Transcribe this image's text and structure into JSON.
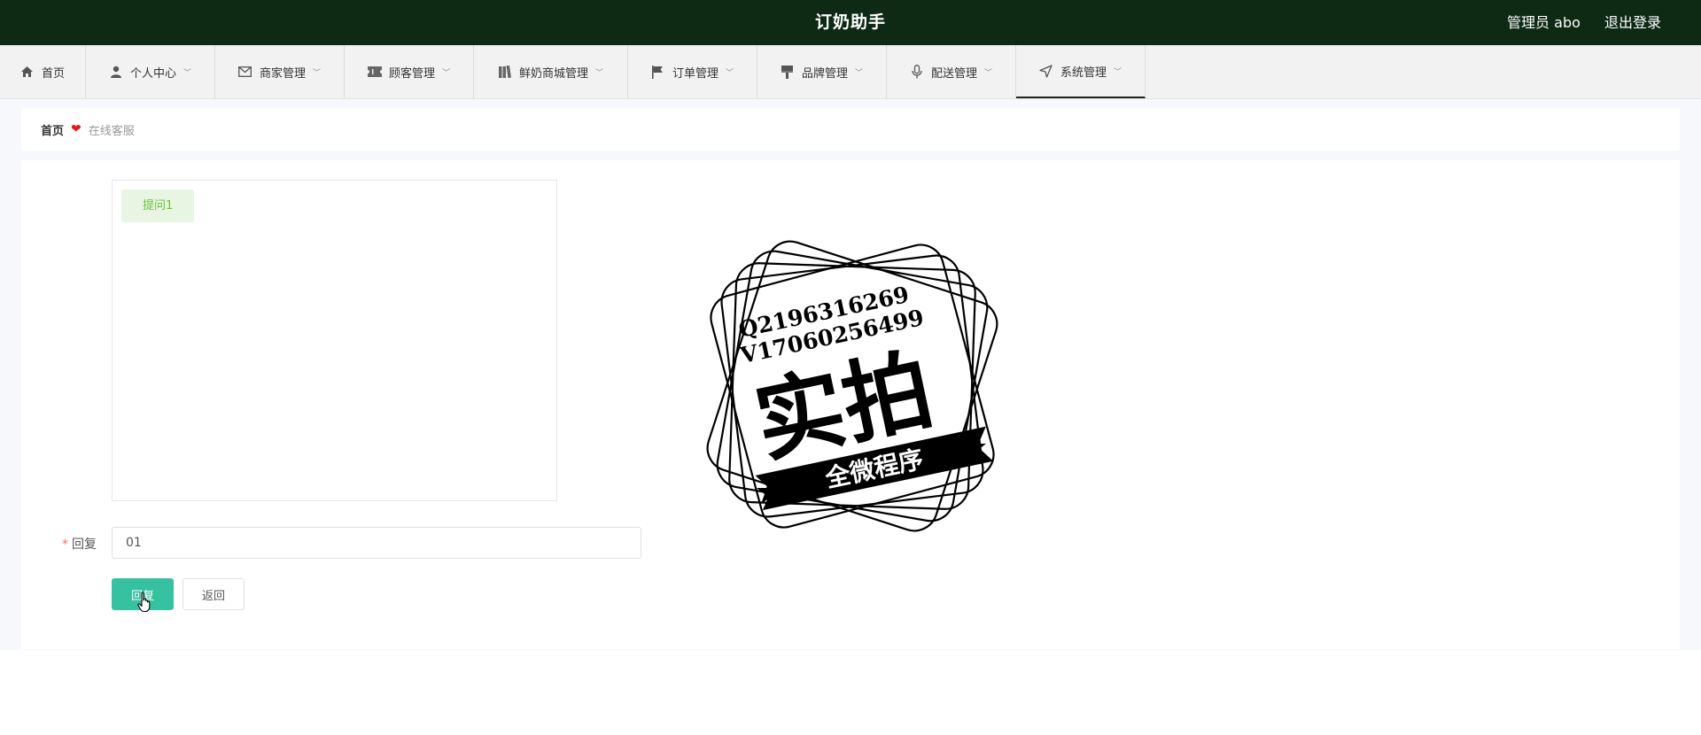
{
  "header": {
    "app_title": "订奶助手",
    "user_label": "管理员 abo",
    "logout_label": "退出登录"
  },
  "nav": [
    {
      "label": "首页",
      "icon": "home-icon",
      "dropdown": false
    },
    {
      "label": "个人中心",
      "icon": "user-icon",
      "dropdown": true
    },
    {
      "label": "商家管理",
      "icon": "mail-icon",
      "dropdown": true
    },
    {
      "label": "顾客管理",
      "icon": "ticket-icon",
      "dropdown": true
    },
    {
      "label": "鲜奶商城管理",
      "icon": "books-icon",
      "dropdown": true
    },
    {
      "label": "订单管理",
      "icon": "flag-icon",
      "dropdown": true
    },
    {
      "label": "品牌管理",
      "icon": "brush-icon",
      "dropdown": true
    },
    {
      "label": "配送管理",
      "icon": "microphone-icon",
      "dropdown": true
    },
    {
      "label": "系统管理",
      "icon": "navigation-icon",
      "dropdown": true,
      "active": true
    }
  ],
  "breadcrumb": {
    "home": "首页",
    "separator_icon": "heart-icon",
    "current": "在线客服"
  },
  "chat": {
    "messages": [
      {
        "text": "提问1"
      }
    ]
  },
  "form": {
    "reply_label": "回复",
    "required_mark": "*",
    "reply_value": "01",
    "submit_label": "回复",
    "back_label": "返回"
  },
  "stamp": {
    "line1": "Q2196316269",
    "line2": "V17060256499",
    "main_text": "实拍",
    "ribbon_text": "全微程序"
  },
  "colors": {
    "header_bg": "#0e2a14",
    "primary_button": "#36c2a0",
    "bubble_bg": "#e8f5e3",
    "bubble_text": "#67c23a",
    "required": "#f56c6c",
    "heart": "#e11b1b"
  }
}
